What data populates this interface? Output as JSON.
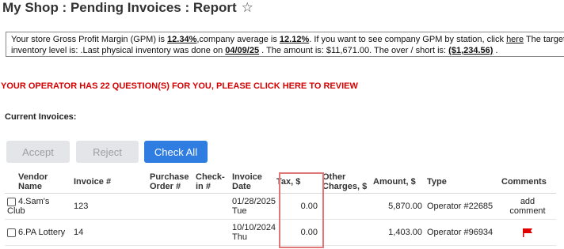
{
  "page": {
    "title": "My Shop : Pending Invoices : Report",
    "favorite_icon": "star-outline-icon"
  },
  "gpm_notice": {
    "text_1": "Your store Gross Profit Margin (GPM) is ",
    "store_gpm": "12.34%",
    "text_2": ",company average is ",
    "company_avg": "12.12%",
    "text_3": ". If you want to see company GPM by station, click ",
    "here_link": "here",
    "text_4": " The target",
    "line2_text_1": "inventory level is: .Last physical inventory was done on ",
    "inventory_date": "04/09/25",
    "line2_text_2": " . The amount is: $11,671.00. The over / short is: ",
    "over_short": "($1,234.56)",
    "line2_text_3": " ."
  },
  "operator_alert": "YOUR OPERATOR HAS 22 QUESTION(S) FOR YOU, PLEASE CLICK HERE TO REVIEW",
  "invoices": {
    "section_label": "Current Invoices:",
    "buttons": {
      "accept": "Accept",
      "reject": "Reject",
      "check_all": "Check All"
    },
    "columns": {
      "vendor": "Vendor Name",
      "invoice_no": "Invoice #",
      "po": "Purchase Order #",
      "checkin": "Check-in #",
      "date": "Invoice Date",
      "tax": "Tax, $",
      "other": "Other Charges, $",
      "amount": "Amount, $",
      "type": "Type",
      "comments": "Comments"
    },
    "rows": [
      {
        "vendor": "4.Sam's Club",
        "invoice_no": "123",
        "po": "",
        "checkin": "",
        "date": "01/28/2025",
        "day": "Tue",
        "tax": "0.00",
        "other": "",
        "amount": "5,870.00",
        "type": "Operator #22685",
        "comment": "add comment"
      },
      {
        "vendor": "6.PA Lottery",
        "invoice_no": "14",
        "po": "",
        "checkin": "",
        "date": "10/10/2024",
        "day": "Thu",
        "tax": "0.00",
        "other": "",
        "amount": "1,403.00",
        "type": "Operator #96934",
        "comment_icon": "red-flag-icon"
      }
    ]
  },
  "colors": {
    "alert": "#d60000",
    "primary_button": "#2f7de1",
    "highlight_box": "#e07777",
    "flag": "#e00000"
  }
}
